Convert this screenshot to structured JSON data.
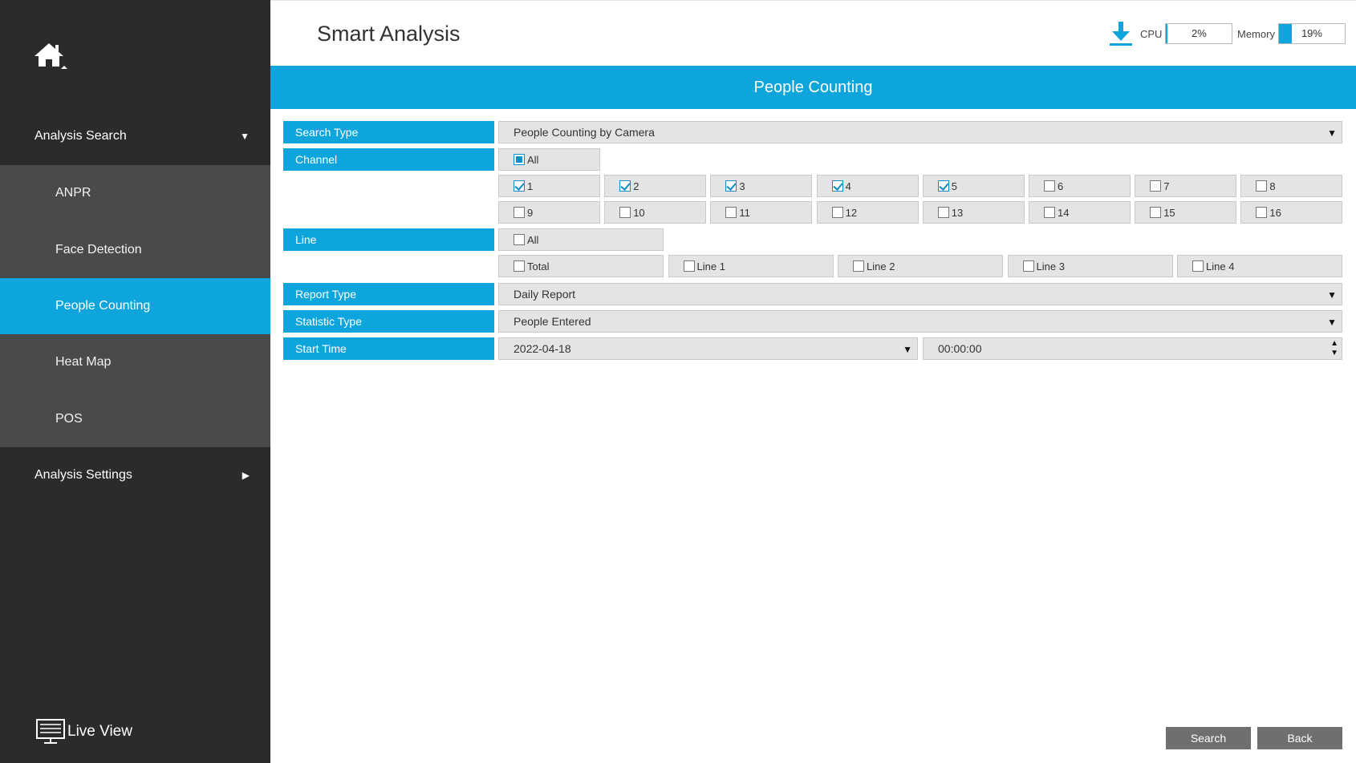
{
  "app": {
    "title": "Smart Analysis",
    "cpu_label": "CPU",
    "cpu_value": "2%",
    "cpu_fraction": 0.02,
    "memory_label": "Memory",
    "memory_value": "19%",
    "memory_fraction": 0.19,
    "accent_color": "#0ea5dc"
  },
  "sidebar": {
    "group_search": "Analysis Search",
    "items": [
      {
        "label": "ANPR"
      },
      {
        "label": "Face Detection"
      },
      {
        "label": "People Counting"
      },
      {
        "label": "Heat Map"
      },
      {
        "label": "POS"
      }
    ],
    "group_settings": "Analysis Settings",
    "live_view": "Live View"
  },
  "section": {
    "title": "People Counting"
  },
  "form": {
    "search_type_label": "Search Type",
    "search_type_value": "People Counting by Camera",
    "channel_label": "Channel",
    "channel_all": "All",
    "channels": [
      {
        "label": "1",
        "checked": true
      },
      {
        "label": "2",
        "checked": true
      },
      {
        "label": "3",
        "checked": true
      },
      {
        "label": "4",
        "checked": true
      },
      {
        "label": "5",
        "checked": true
      },
      {
        "label": "6",
        "checked": false
      },
      {
        "label": "7",
        "checked": false
      },
      {
        "label": "8",
        "checked": false
      },
      {
        "label": "9",
        "checked": false
      },
      {
        "label": "10",
        "checked": false
      },
      {
        "label": "11",
        "checked": false
      },
      {
        "label": "12",
        "checked": false
      },
      {
        "label": "13",
        "checked": false
      },
      {
        "label": "14",
        "checked": false
      },
      {
        "label": "15",
        "checked": false
      },
      {
        "label": "16",
        "checked": false
      }
    ],
    "line_label": "Line",
    "line_all": "All",
    "lines": [
      {
        "label": "Total",
        "checked": false
      },
      {
        "label": "Line 1",
        "checked": false
      },
      {
        "label": "Line 2",
        "checked": false
      },
      {
        "label": "Line 3",
        "checked": false
      },
      {
        "label": "Line 4",
        "checked": false
      }
    ],
    "report_type_label": "Report Type",
    "report_type_value": "Daily Report",
    "statistic_type_label": "Statistic Type",
    "statistic_type_value": "People Entered",
    "start_time_label": "Start Time",
    "start_date_value": "2022-04-18",
    "start_time_value": "00:00:00"
  },
  "buttons": {
    "search": "Search",
    "back": "Back"
  }
}
